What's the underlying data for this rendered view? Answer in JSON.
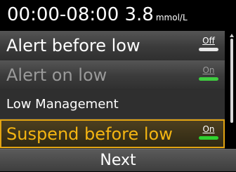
{
  "header": {
    "time_range_value": "00:00-08:00 3.8",
    "unit": "mmol/L"
  },
  "rows": [
    {
      "label": "Alert before low",
      "toggle": "Off",
      "state": "off",
      "enabled": true
    },
    {
      "label": "Alert on low",
      "toggle": "On",
      "state": "on",
      "enabled": false
    },
    {
      "label": "Low Management",
      "section": true
    },
    {
      "label": "Suspend before low",
      "toggle": "On",
      "state": "on",
      "enabled": true,
      "selected": true
    }
  ],
  "footer": {
    "next_label": "Next"
  },
  "colors": {
    "selection_highlight": "#e2a412",
    "toggle_on": "#2fd12f",
    "disabled_text": "#9a9a9a"
  }
}
